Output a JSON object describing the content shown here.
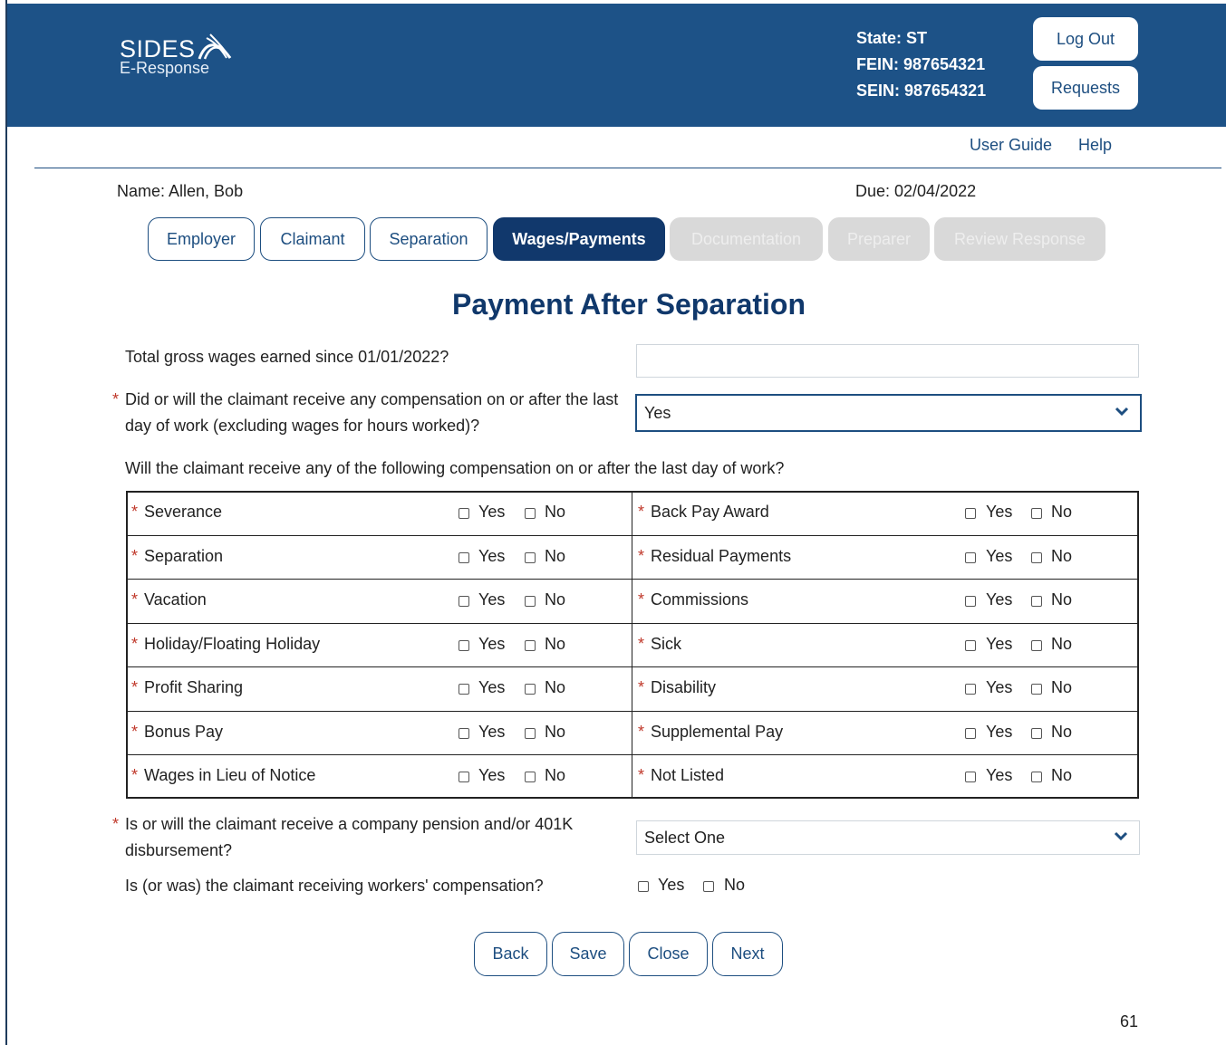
{
  "header": {
    "logo_main": "SIDES",
    "logo_sub": "E-Response",
    "state": "State: ST",
    "fein": "FEIN: 987654321",
    "sein": "SEIN: 987654321",
    "logout_label": "Log Out",
    "requests_label": "Requests"
  },
  "links": {
    "user_guide": "User Guide",
    "help": "Help"
  },
  "meta": {
    "name": "Name:  Allen, Bob",
    "due": "Due:  02/04/2022"
  },
  "tabs": [
    {
      "label": "Employer",
      "state": "normal"
    },
    {
      "label": "Claimant",
      "state": "normal"
    },
    {
      "label": "Separation",
      "state": "normal"
    },
    {
      "label": "Wages/Payments",
      "state": "active"
    },
    {
      "label": "Documentation",
      "state": "disabled"
    },
    {
      "label": "Preparer",
      "state": "disabled"
    },
    {
      "label": "Review Response",
      "state": "disabled"
    }
  ],
  "page_title": "Payment After Separation",
  "questions": {
    "gross_wages": "Total gross wages earned since 01/01/2022?",
    "gross_wages_value": "",
    "compensation": "Did or will the claimant receive any compensation on or after the last day of work (excluding wages for hours worked)?",
    "compensation_value": "Yes",
    "following": "Will the claimant receive any of the following compensation on or after the last day of work?",
    "pension": "Is or will the claimant receive a company pension and/or 401K disbursement?",
    "pension_value": "Select One",
    "workers_comp": "Is (or was) the claimant receiving workers' compensation?"
  },
  "options": {
    "yes": "Yes",
    "no": "No"
  },
  "comp_rows": [
    {
      "left": "Severance",
      "right": "Back Pay Award"
    },
    {
      "left": "Separation",
      "right": "Residual Payments"
    },
    {
      "left": "Vacation",
      "right": "Commissions"
    },
    {
      "left": "Holiday/Floating Holiday",
      "right": "Sick"
    },
    {
      "left": "Profit Sharing",
      "right": "Disability"
    },
    {
      "left": "Bonus Pay",
      "right": "Supplemental Pay"
    },
    {
      "left": "Wages in Lieu of Notice",
      "right": "Not Listed"
    }
  ],
  "footer_buttons": {
    "back": "Back",
    "save": "Save",
    "close": "Close",
    "next": "Next"
  },
  "page_number": "61",
  "colors": {
    "header_bg": "#1d5287",
    "active_tab": "#11386c",
    "title": "#10386b",
    "required": "#c0392b"
  }
}
